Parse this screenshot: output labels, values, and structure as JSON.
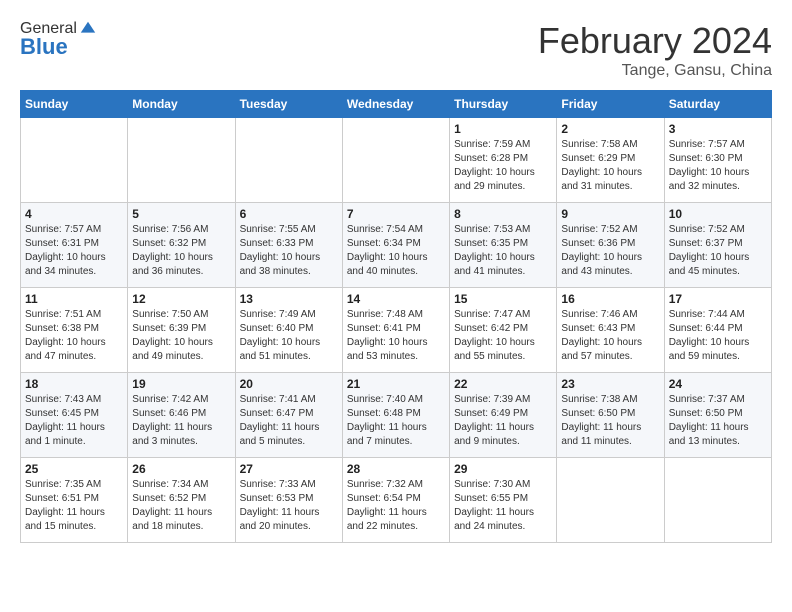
{
  "header": {
    "logo_general": "General",
    "logo_blue": "Blue",
    "month": "February 2024",
    "location": "Tange, Gansu, China"
  },
  "days_of_week": [
    "Sunday",
    "Monday",
    "Tuesday",
    "Wednesday",
    "Thursday",
    "Friday",
    "Saturday"
  ],
  "weeks": [
    [
      {
        "day": "",
        "sunrise": "",
        "sunset": "",
        "daylight": ""
      },
      {
        "day": "",
        "sunrise": "",
        "sunset": "",
        "daylight": ""
      },
      {
        "day": "",
        "sunrise": "",
        "sunset": "",
        "daylight": ""
      },
      {
        "day": "",
        "sunrise": "",
        "sunset": "",
        "daylight": ""
      },
      {
        "day": "1",
        "sunrise": "Sunrise: 7:59 AM",
        "sunset": "Sunset: 6:28 PM",
        "daylight": "Daylight: 10 hours and 29 minutes."
      },
      {
        "day": "2",
        "sunrise": "Sunrise: 7:58 AM",
        "sunset": "Sunset: 6:29 PM",
        "daylight": "Daylight: 10 hours and 31 minutes."
      },
      {
        "day": "3",
        "sunrise": "Sunrise: 7:57 AM",
        "sunset": "Sunset: 6:30 PM",
        "daylight": "Daylight: 10 hours and 32 minutes."
      }
    ],
    [
      {
        "day": "4",
        "sunrise": "Sunrise: 7:57 AM",
        "sunset": "Sunset: 6:31 PM",
        "daylight": "Daylight: 10 hours and 34 minutes."
      },
      {
        "day": "5",
        "sunrise": "Sunrise: 7:56 AM",
        "sunset": "Sunset: 6:32 PM",
        "daylight": "Daylight: 10 hours and 36 minutes."
      },
      {
        "day": "6",
        "sunrise": "Sunrise: 7:55 AM",
        "sunset": "Sunset: 6:33 PM",
        "daylight": "Daylight: 10 hours and 38 minutes."
      },
      {
        "day": "7",
        "sunrise": "Sunrise: 7:54 AM",
        "sunset": "Sunset: 6:34 PM",
        "daylight": "Daylight: 10 hours and 40 minutes."
      },
      {
        "day": "8",
        "sunrise": "Sunrise: 7:53 AM",
        "sunset": "Sunset: 6:35 PM",
        "daylight": "Daylight: 10 hours and 41 minutes."
      },
      {
        "day": "9",
        "sunrise": "Sunrise: 7:52 AM",
        "sunset": "Sunset: 6:36 PM",
        "daylight": "Daylight: 10 hours and 43 minutes."
      },
      {
        "day": "10",
        "sunrise": "Sunrise: 7:52 AM",
        "sunset": "Sunset: 6:37 PM",
        "daylight": "Daylight: 10 hours and 45 minutes."
      }
    ],
    [
      {
        "day": "11",
        "sunrise": "Sunrise: 7:51 AM",
        "sunset": "Sunset: 6:38 PM",
        "daylight": "Daylight: 10 hours and 47 minutes."
      },
      {
        "day": "12",
        "sunrise": "Sunrise: 7:50 AM",
        "sunset": "Sunset: 6:39 PM",
        "daylight": "Daylight: 10 hours and 49 minutes."
      },
      {
        "day": "13",
        "sunrise": "Sunrise: 7:49 AM",
        "sunset": "Sunset: 6:40 PM",
        "daylight": "Daylight: 10 hours and 51 minutes."
      },
      {
        "day": "14",
        "sunrise": "Sunrise: 7:48 AM",
        "sunset": "Sunset: 6:41 PM",
        "daylight": "Daylight: 10 hours and 53 minutes."
      },
      {
        "day": "15",
        "sunrise": "Sunrise: 7:47 AM",
        "sunset": "Sunset: 6:42 PM",
        "daylight": "Daylight: 10 hours and 55 minutes."
      },
      {
        "day": "16",
        "sunrise": "Sunrise: 7:46 AM",
        "sunset": "Sunset: 6:43 PM",
        "daylight": "Daylight: 10 hours and 57 minutes."
      },
      {
        "day": "17",
        "sunrise": "Sunrise: 7:44 AM",
        "sunset": "Sunset: 6:44 PM",
        "daylight": "Daylight: 10 hours and 59 minutes."
      }
    ],
    [
      {
        "day": "18",
        "sunrise": "Sunrise: 7:43 AM",
        "sunset": "Sunset: 6:45 PM",
        "daylight": "Daylight: 11 hours and 1 minute."
      },
      {
        "day": "19",
        "sunrise": "Sunrise: 7:42 AM",
        "sunset": "Sunset: 6:46 PM",
        "daylight": "Daylight: 11 hours and 3 minutes."
      },
      {
        "day": "20",
        "sunrise": "Sunrise: 7:41 AM",
        "sunset": "Sunset: 6:47 PM",
        "daylight": "Daylight: 11 hours and 5 minutes."
      },
      {
        "day": "21",
        "sunrise": "Sunrise: 7:40 AM",
        "sunset": "Sunset: 6:48 PM",
        "daylight": "Daylight: 11 hours and 7 minutes."
      },
      {
        "day": "22",
        "sunrise": "Sunrise: 7:39 AM",
        "sunset": "Sunset: 6:49 PM",
        "daylight": "Daylight: 11 hours and 9 minutes."
      },
      {
        "day": "23",
        "sunrise": "Sunrise: 7:38 AM",
        "sunset": "Sunset: 6:50 PM",
        "daylight": "Daylight: 11 hours and 11 minutes."
      },
      {
        "day": "24",
        "sunrise": "Sunrise: 7:37 AM",
        "sunset": "Sunset: 6:50 PM",
        "daylight": "Daylight: 11 hours and 13 minutes."
      }
    ],
    [
      {
        "day": "25",
        "sunrise": "Sunrise: 7:35 AM",
        "sunset": "Sunset: 6:51 PM",
        "daylight": "Daylight: 11 hours and 15 minutes."
      },
      {
        "day": "26",
        "sunrise": "Sunrise: 7:34 AM",
        "sunset": "Sunset: 6:52 PM",
        "daylight": "Daylight: 11 hours and 18 minutes."
      },
      {
        "day": "27",
        "sunrise": "Sunrise: 7:33 AM",
        "sunset": "Sunset: 6:53 PM",
        "daylight": "Daylight: 11 hours and 20 minutes."
      },
      {
        "day": "28",
        "sunrise": "Sunrise: 7:32 AM",
        "sunset": "Sunset: 6:54 PM",
        "daylight": "Daylight: 11 hours and 22 minutes."
      },
      {
        "day": "29",
        "sunrise": "Sunrise: 7:30 AM",
        "sunset": "Sunset: 6:55 PM",
        "daylight": "Daylight: 11 hours and 24 minutes."
      },
      {
        "day": "",
        "sunrise": "",
        "sunset": "",
        "daylight": ""
      },
      {
        "day": "",
        "sunrise": "",
        "sunset": "",
        "daylight": ""
      }
    ]
  ]
}
